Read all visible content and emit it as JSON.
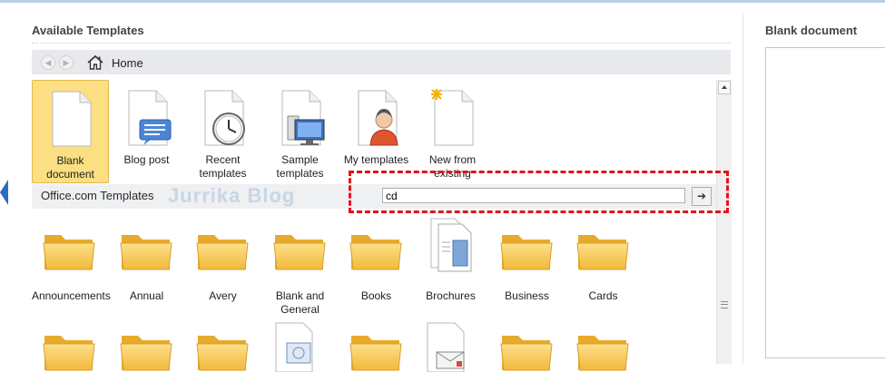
{
  "available_templates": {
    "title": "Available Templates"
  },
  "nav": {
    "home_label": "Home"
  },
  "templates": [
    {
      "label": "Blank document",
      "icon": "blank-document-icon",
      "selected": true
    },
    {
      "label": "Blog post",
      "icon": "blog-post-icon"
    },
    {
      "label": "Recent templates",
      "icon": "recent-templates-icon"
    },
    {
      "label": "Sample templates",
      "icon": "sample-templates-icon"
    },
    {
      "label": "My templates",
      "icon": "my-templates-icon"
    },
    {
      "label": "New from existing",
      "icon": "new-from-existing-icon"
    }
  ],
  "office": {
    "label": "Office.com Templates",
    "search_value": "cd",
    "go_label": "➔",
    "watermark": "Jurrika Blog"
  },
  "categories": [
    {
      "label": "Announcements",
      "icon": "folder-icon"
    },
    {
      "label": "Annual",
      "icon": "folder-icon"
    },
    {
      "label": "Avery",
      "icon": "folder-icon"
    },
    {
      "label": "Blank and General",
      "icon": "folder-icon"
    },
    {
      "label": "Books",
      "icon": "folder-icon"
    },
    {
      "label": "Brochures",
      "icon": "brochure-icon"
    },
    {
      "label": "Business",
      "icon": "folder-icon"
    },
    {
      "label": "Cards",
      "icon": "folder-icon"
    }
  ],
  "preview": {
    "title": "Blank document"
  },
  "colors": {
    "selection": "#fcdf83",
    "highlight": "#e2141c",
    "folder": "#f5c244"
  }
}
